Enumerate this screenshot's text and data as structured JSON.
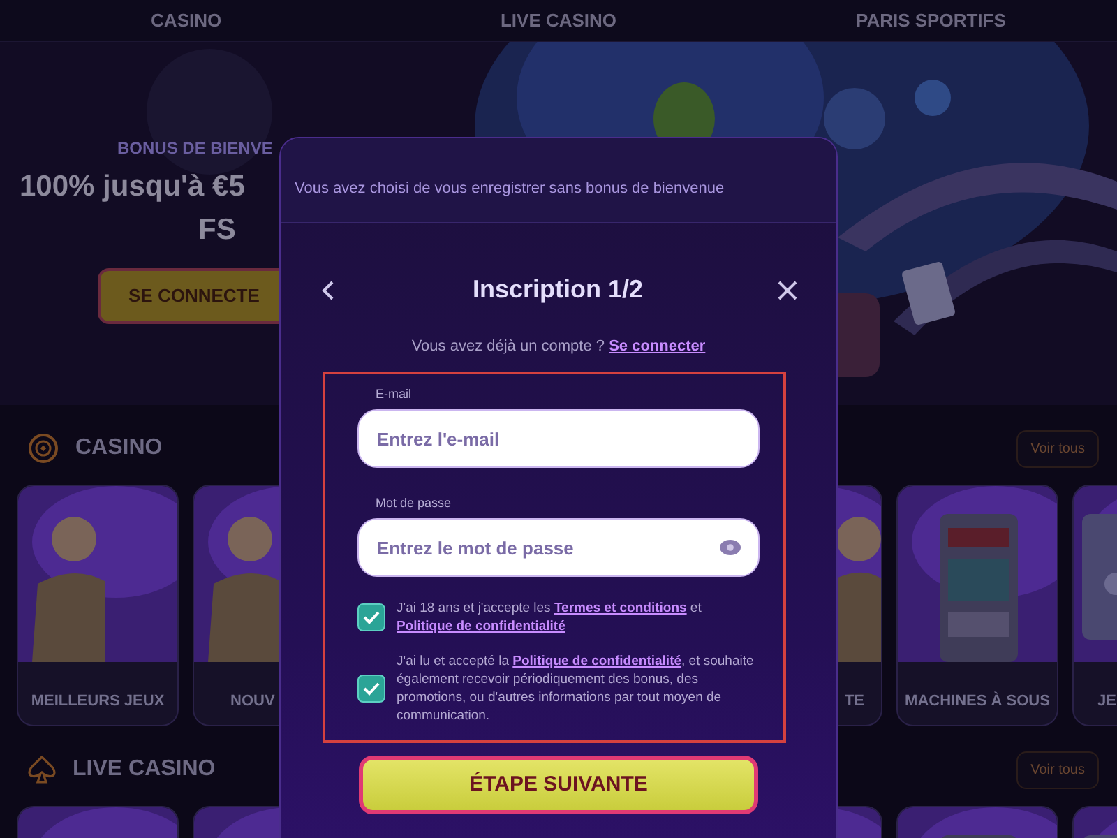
{
  "nav": [
    {
      "label": "CASINO"
    },
    {
      "label": "LIVE CASINO"
    },
    {
      "label": "PARIS SPORTIFS"
    }
  ],
  "hero": {
    "kind": "picture",
    "eyebrow": "BONUS DE BIENVE",
    "headline": [
      "100% jusqu'à €5",
      "FS"
    ],
    "button": "SE CONNECTE"
  },
  "sections": [
    {
      "title": "CASINO",
      "action": "Voir tous",
      "cards": [
        {
          "kind": "picture",
          "label": "MEILLEURS JEUX"
        },
        {
          "kind": "picture",
          "label": "NOUV"
        },
        {
          "kind": "picture",
          "label": "TE"
        },
        {
          "kind": "picture",
          "label": "MACHINES À SOUS"
        },
        {
          "kind": "picture",
          "label": "JE"
        }
      ]
    },
    {
      "title": "LIVE CASINO",
      "action": "Voir tous"
    }
  ],
  "modal": {
    "notice": "Vous avez choisi de vous enregistrer sans bonus de bienvenue",
    "title": "Inscription 1/2",
    "login_prompt": "Vous avez déjà un compte ?",
    "login_link": "Se connecter",
    "fields": [
      {
        "kind": "email",
        "label": "E-mail",
        "placeholder": "Entrez l'e-mail"
      },
      {
        "kind": "password",
        "label": "Mot de passe",
        "placeholder": "Entrez le mot de passe"
      }
    ],
    "consents": [
      {
        "checked": true,
        "parts": [
          {
            "text": "J'ai 18 ans et j'accepte les "
          },
          {
            "link": "Termes et conditions"
          },
          {
            "text": " et "
          },
          {
            "link": "Politique de confidentialité"
          }
        ]
      },
      {
        "checked": true,
        "parts": [
          {
            "text": "J'ai lu et accepté la "
          },
          {
            "link": "Politique de confidentialité"
          },
          {
            "text": ", et souhaite également recevoir périodiquement des bonus, des promotions, ou d'autres informations par tout moyen de communication."
          }
        ]
      }
    ],
    "submit": "ÉTAPE SUIVANTE"
  }
}
